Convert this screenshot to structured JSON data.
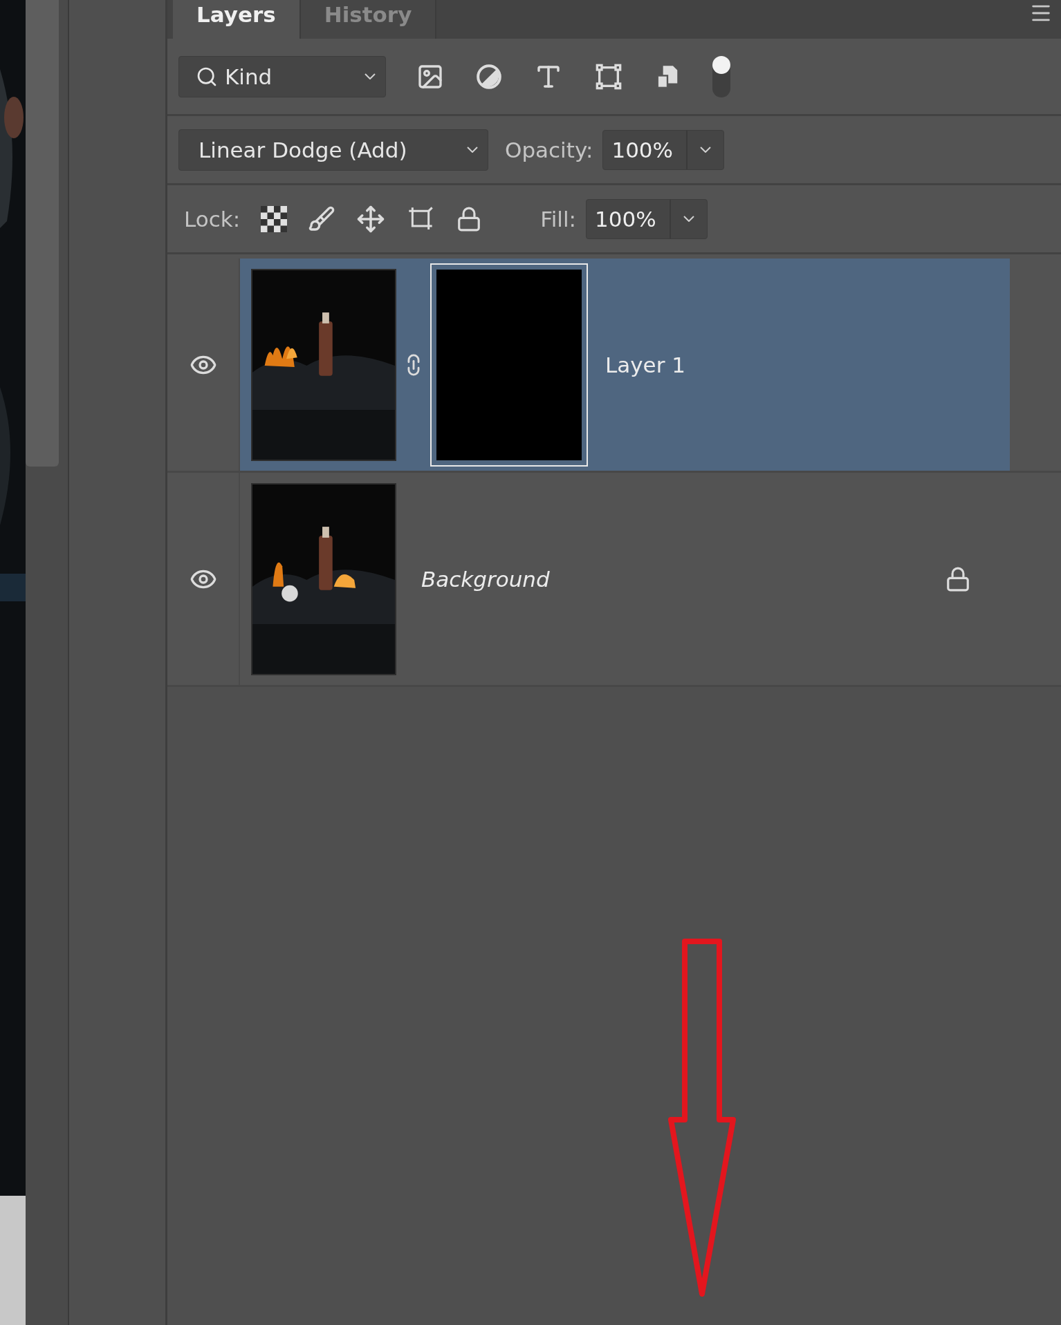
{
  "tabs": [
    {
      "label": "Layers",
      "selected": true
    },
    {
      "label": "History",
      "selected": false
    }
  ],
  "filter": {
    "value": "Kind",
    "toggle_on": true
  },
  "blend_mode": {
    "value": "Linear Dodge (Add)"
  },
  "opacity": {
    "label": "Opacity:",
    "value": "100%"
  },
  "lock": {
    "label": "Lock:"
  },
  "fill": {
    "label": "Fill:",
    "value": "100%"
  },
  "layers": [
    {
      "name": "Layer 1",
      "kind": "layer",
      "selected": true,
      "visible": true,
      "has_mask": true,
      "locked": false
    },
    {
      "name": "Background",
      "kind": "background",
      "selected": false,
      "visible": true,
      "has_mask": false,
      "locked": true
    }
  ]
}
